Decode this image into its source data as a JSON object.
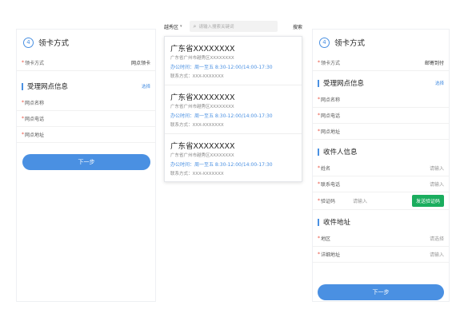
{
  "left": {
    "step_number": "4",
    "step_title": "领卡方式",
    "method_label": "领卡方式",
    "method_value": "网点领卡",
    "section_title": "受理网点信息",
    "select_link": "选择",
    "fields": [
      "网点名称",
      "网点电话",
      "网点地址"
    ],
    "next_button": "下一步"
  },
  "middle": {
    "district": "越秀区",
    "search_placeholder": "请输入搜索关键词",
    "search_button": "搜索",
    "cards": [
      {
        "title": "广东省XXXXXXXX",
        "address": "广东省广州市越秀区XXXXXXXX",
        "hours": "办公时间：周一至五 8:30-12:00/14:00-17:30",
        "phone": "联系方式：XXX-XXXXXXX"
      },
      {
        "title": "广东省XXXXXXXX",
        "address": "广东省广州市越秀区XXXXXXXX",
        "hours": "办公时间：周一至五 8:30-12:00/14:00-17:30",
        "phone": "联系方式：XXX-XXXXXXX"
      },
      {
        "title": "广东省XXXXXXXX",
        "address": "广东省广州市越秀区XXXXXXXX",
        "hours": "办公时间：周一至五 8:30-12:00/14:00-17:30",
        "phone": "联系方式：XXX-XXXXXXX"
      }
    ]
  },
  "right": {
    "step_number": "4",
    "step_title": "领卡方式",
    "method_label": "领卡方式",
    "method_value": "邮寄到付",
    "section1_title": "受理网点信息",
    "select_link": "选择",
    "section1_fields": [
      "网点名称",
      "网点电话",
      "网点地址"
    ],
    "section2_title": "收件人信息",
    "name_label": "姓名",
    "name_placeholder": "请输入",
    "phone_label": "联系电话",
    "phone_placeholder": "请输入",
    "code_label": "验证码",
    "code_placeholder": "请输入",
    "code_button": "发送验证码",
    "section3_title": "收件地址",
    "region_label": "地区",
    "region_placeholder": "请选择",
    "detail_label": "详细地址",
    "detail_placeholder": "请输入",
    "next_button": "下一步"
  },
  "colors": {
    "accent": "#4a90e2",
    "required": "#e74c3c",
    "code_button": "#1aad5e"
  }
}
